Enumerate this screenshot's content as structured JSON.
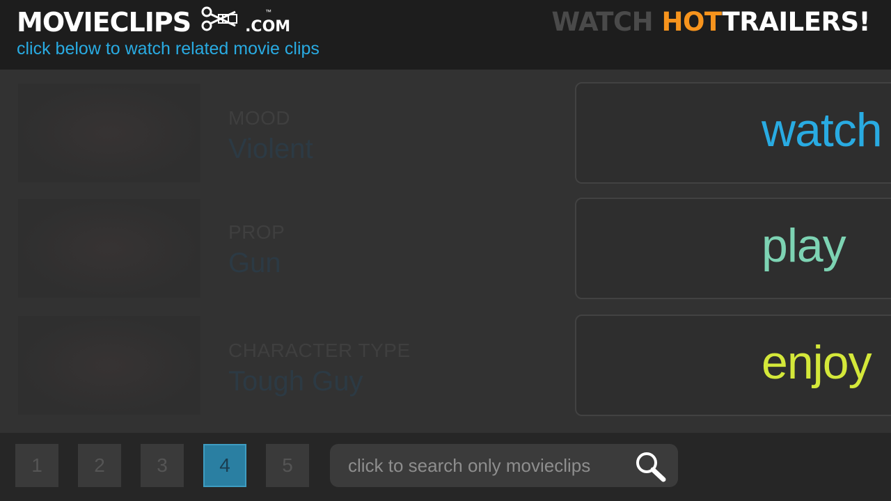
{
  "header": {
    "logo_text": "MOVIECLIPS",
    "logo_suffix": ".COM",
    "logo_tm": "™",
    "tagline": "click below to watch related movie clips",
    "trailers": {
      "watch": "WATCH ",
      "hot": "HOT",
      "rest": "TRAILERS!"
    },
    "colors": {
      "tagline": "#29abe2",
      "hot": "#f7941d"
    }
  },
  "rows": [
    {
      "label": "MOOD",
      "value": "Violent",
      "action": "watch",
      "action_color": "#29abe2"
    },
    {
      "label": "PROP",
      "value": "Gun",
      "action": "play",
      "action_color": "#7dd3b3"
    },
    {
      "label": "CHARACTER TYPE",
      "value": "Tough Guy",
      "action": "enjoy",
      "action_color": "#d4e83a"
    }
  ],
  "pagination": {
    "pages": [
      "1",
      "2",
      "3",
      "4",
      "5"
    ],
    "active": "4"
  },
  "search": {
    "placeholder": "click to search only movieclips",
    "icon": "search-icon"
  }
}
